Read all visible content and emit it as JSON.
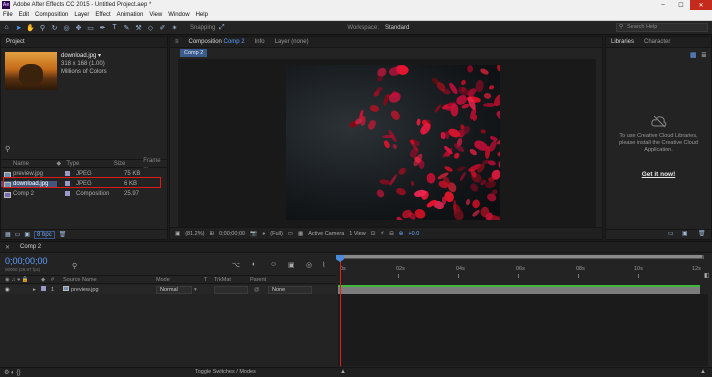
{
  "titlebar": {
    "app_icon": "Ae",
    "title": "Adobe After Effects CC 2015 - Untitled Project.aep *",
    "minimize": "–",
    "maximize": "☐",
    "close": "✕"
  },
  "menu": [
    "File",
    "Edit",
    "Composition",
    "Layer",
    "Effect",
    "Animation",
    "View",
    "Window",
    "Help"
  ],
  "toolbar": {
    "snapping": "Snapping",
    "workspace_label": "Workspace:",
    "workspace_value": "Standard",
    "search_placeholder": "Search Help"
  },
  "project": {
    "tab": "Project",
    "thumb_name": "download.jpg ▾",
    "thumb_size": "318 x 168 (1.00)",
    "thumb_colors": "Millions of Colors",
    "columns": [
      "Name",
      "Type",
      "Size",
      "Frame ..."
    ],
    "items": [
      {
        "name": "preview.jpg",
        "type": "JPEG",
        "size": "75 KB"
      },
      {
        "name": "download.jpg",
        "type": "JPEG",
        "size": "6 KB"
      },
      {
        "name": "Comp 2",
        "type": "Composition",
        "size": "25.97"
      }
    ],
    "bpc": "8 bpc"
  },
  "composition": {
    "tab_prefix": "Composition",
    "tab_comp": "Comp 2",
    "tab_info": "Info",
    "tab_layer": "Layer (none)",
    "subtab": "Comp 2",
    "zoom": "(81.2%)",
    "timecode": "0;00;00;00",
    "resolution": "(Full)",
    "camera": "Active Camera",
    "view": "1 View",
    "exposure": "+0.0"
  },
  "libraries": {
    "tab_libraries": "Libraries",
    "tab_character": "Character",
    "message_line1": "To use Creative Cloud Libraries,",
    "message_line2": "please install the Creative Cloud",
    "message_line3": "Application.",
    "get_it": "Get it now!"
  },
  "timeline": {
    "tab": "Comp 2",
    "timecode": "0;00;00;00",
    "timecode_sub": "00000 (29.97 fps)",
    "columns": {
      "source": "Source Name",
      "mode": "Mode",
      "t": "T",
      "trkmat": "TrkMat",
      "parent": "Parent"
    },
    "layer": {
      "index": "1",
      "name": "preview.jpg",
      "mode": "Normal",
      "parent": "None"
    },
    "ruler_ticks": [
      "0s",
      "02s",
      "04s",
      "06s",
      "08s",
      "10s",
      "12s"
    ],
    "toggle": "Toggle Switches / Modes"
  }
}
